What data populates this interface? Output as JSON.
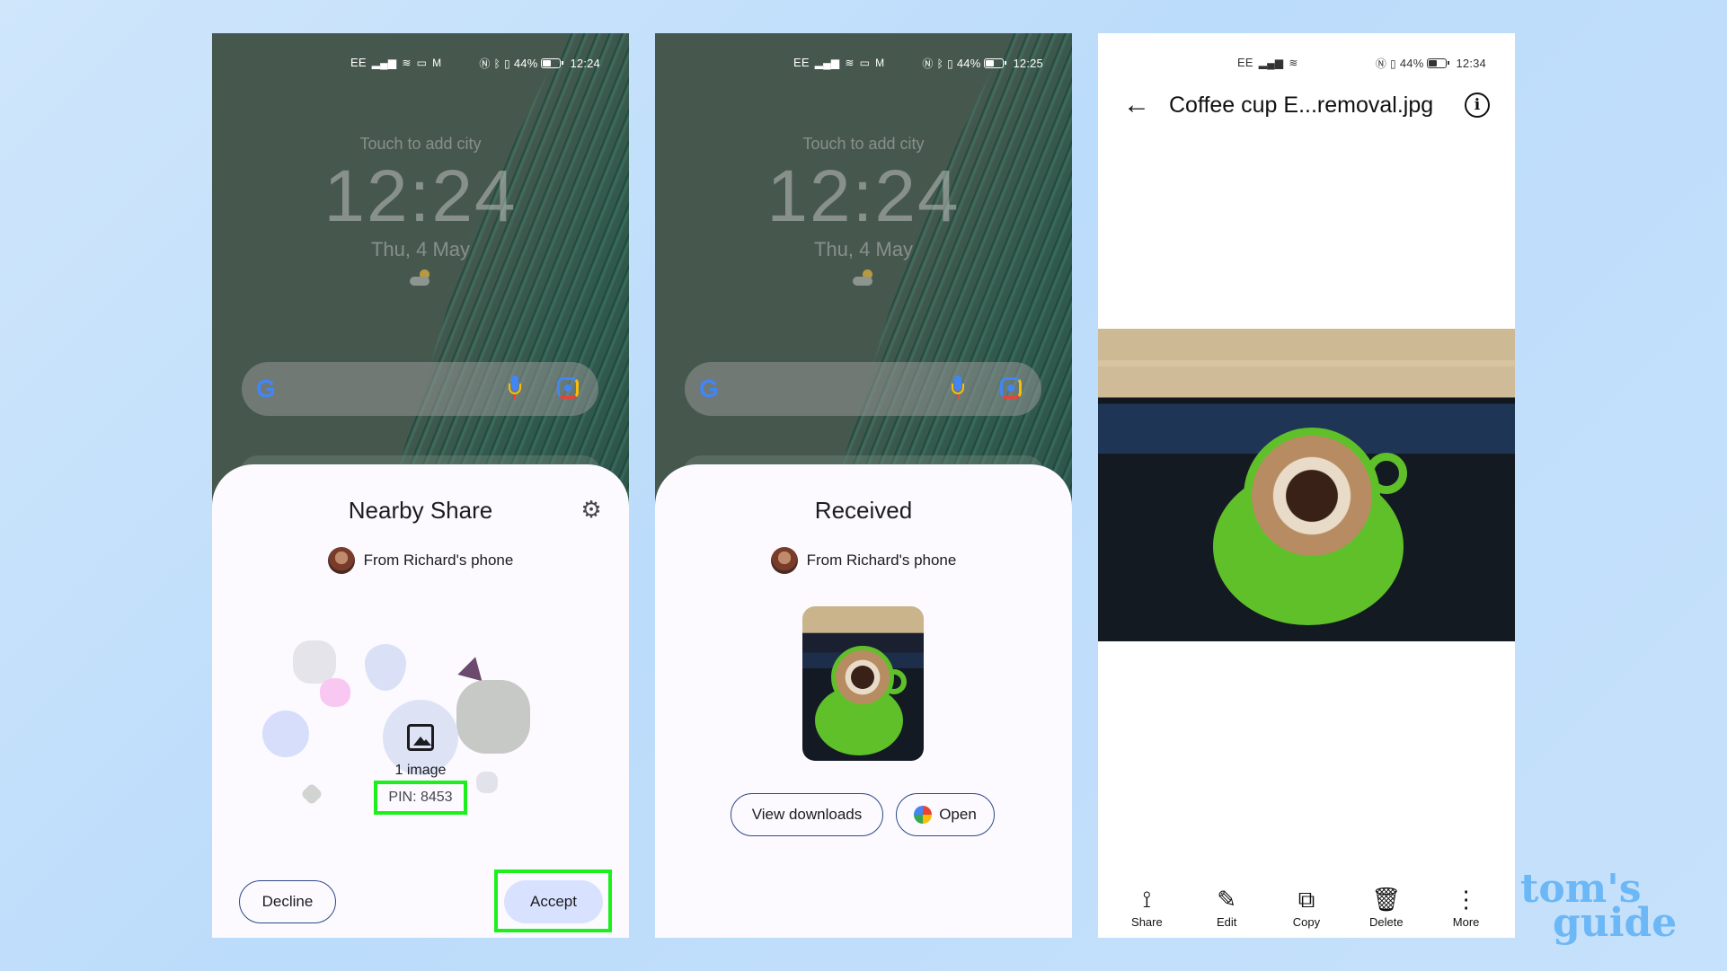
{
  "phone1": {
    "status": {
      "carrier": "EE",
      "battery": "44%",
      "time": "12:24"
    },
    "lock": {
      "city_hint": "Touch to add city",
      "clock": "12:24",
      "date": "Thu, 4 May"
    },
    "sheet": {
      "title": "Nearby Share",
      "from": "From Richard's phone",
      "item_count": "1 image",
      "pin": "PIN: 8453",
      "decline_label": "Decline",
      "accept_label": "Accept"
    }
  },
  "phone2": {
    "status": {
      "carrier": "EE",
      "battery": "44%",
      "time": "12:25"
    },
    "lock": {
      "city_hint": "Touch to add city",
      "clock": "12:24",
      "date": "Thu, 4 May"
    },
    "sheet": {
      "title": "Received",
      "from": "From Richard's phone",
      "view_downloads_label": "View downloads",
      "open_label": "Open"
    }
  },
  "phone3": {
    "status": {
      "carrier": "EE",
      "battery": "44%",
      "time": "12:34"
    },
    "title": "Coffee cup E...removal.jpg",
    "toolbar": [
      {
        "label": "Share",
        "icon": "share-icon"
      },
      {
        "label": "Edit",
        "icon": "pencil-icon"
      },
      {
        "label": "Copy",
        "icon": "copy-icon"
      },
      {
        "label": "Delete",
        "icon": "trash-icon"
      },
      {
        "label": "More",
        "icon": "more-vert-icon"
      }
    ]
  },
  "brand": {
    "line1": "tom's",
    "line2": "guide"
  },
  "colors": {
    "highlight": "#1cf01c",
    "accent_button": "#d8e2ff",
    "outline": "#2c4a86"
  }
}
